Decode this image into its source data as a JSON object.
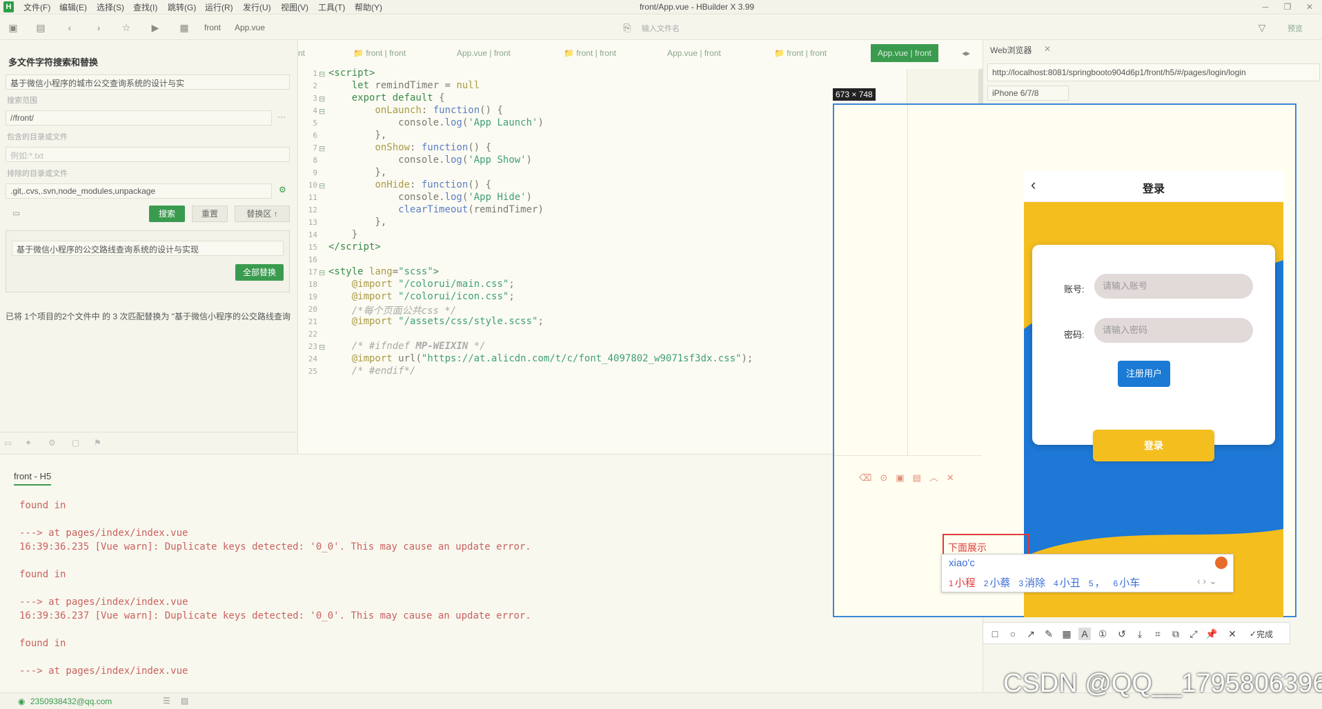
{
  "menubar": {
    "items": [
      "文件(F)",
      "编辑(E)",
      "选择(S)",
      "查找(I)",
      "跳转(G)",
      "运行(R)",
      "发行(U)",
      "视图(V)",
      "工具(T)",
      "帮助(Y)"
    ],
    "window_title": "front/App.vue - HBuilder X 3.99"
  },
  "toolbar": {
    "breadcrumb": [
      "front",
      "App.vue"
    ],
    "file_input_placeholder": "输入文件名",
    "preview_label": "预览"
  },
  "search_panel": {
    "title": "多文件字符搜索和替换",
    "search_value": "基于微信小程序的城市公交查询系统的设计与实",
    "scope_label": "搜索范围",
    "scope_value": "//front/",
    "include_label": "包含的目录或文件",
    "include_placeholder": "例如:*.txt",
    "exclude_label": "排除的目录或文件",
    "exclude_value": ".git,.cvs,.svn,node_modules,unpackage",
    "search_button": "搜索",
    "reset_button": "重置",
    "replace_toggle": "替换区 ↑",
    "replace_value": "基于微信小程序的公交路线查询系统的设计与实现",
    "replace_all_button": "全部替换",
    "result_text": "已将 1个项目的2个文件中 的 3 次匹配替换为 \"基于微信小程序的公交路线查询"
  },
  "editor": {
    "tabs": [
      "nt",
      "front | front",
      "App.vue | front",
      "front | front",
      "App.vue | front",
      "front | front",
      "App.vue | front"
    ],
    "code_lines": [
      {
        "n": "1",
        "fold": "⊟",
        "html": "<span class=\"kw\">&lt;script&gt;</span>"
      },
      {
        "n": "2",
        "fold": "",
        "html": "    <span class=\"kw\">let</span> remindTimer = <span class=\"prop\">null</span>"
      },
      {
        "n": "3",
        "fold": "⊟",
        "html": "    <span class=\"kw\">export default</span> {"
      },
      {
        "n": "4",
        "fold": "⊟",
        "html": "        <span class=\"prop\">onLaunch</span>: <span class=\"fn\">function</span>() {"
      },
      {
        "n": "5",
        "fold": "",
        "html": "            console.<span class=\"fn\">log</span>(<span class=\"str\">'App Launch'</span>)"
      },
      {
        "n": "6",
        "fold": "",
        "html": "        },"
      },
      {
        "n": "7",
        "fold": "⊟",
        "html": "        <span class=\"prop\">onShow</span>: <span class=\"fn\">function</span>() {"
      },
      {
        "n": "8",
        "fold": "",
        "html": "            console.<span class=\"fn\">log</span>(<span class=\"str\">'App Show'</span>)"
      },
      {
        "n": "9",
        "fold": "",
        "html": "        },"
      },
      {
        "n": "10",
        "fold": "⊟",
        "html": "        <span class=\"prop\">onHide</span>: <span class=\"fn\">function</span>() {"
      },
      {
        "n": "11",
        "fold": "",
        "html": "            console.<span class=\"fn\">log</span>(<span class=\"str\">'App Hide'</span>)"
      },
      {
        "n": "12",
        "fold": "",
        "html": "            <span class=\"fn\">clearTimeout</span>(remindTimer)"
      },
      {
        "n": "13",
        "fold": "",
        "html": "        },"
      },
      {
        "n": "14",
        "fold": "",
        "html": "    }"
      },
      {
        "n": "15",
        "fold": "",
        "html": "<span class=\"kw\">&lt;/script&gt;</span>"
      },
      {
        "n": "16",
        "fold": "",
        "html": ""
      },
      {
        "n": "17",
        "fold": "⊟",
        "html": "<span class=\"kw\">&lt;style</span> <span class=\"prop\">lang</span>=<span class=\"str\">\"scss\"</span><span class=\"kw\">&gt;</span>"
      },
      {
        "n": "18",
        "fold": "",
        "html": "    <span class=\"prop\">@import</span> <span class=\"str\">\"/colorui/main.css\"</span>;"
      },
      {
        "n": "19",
        "fold": "",
        "html": "    <span class=\"prop\">@import</span> <span class=\"str\">\"/colorui/icon.css\"</span>;"
      },
      {
        "n": "20",
        "fold": "",
        "html": "    <span class=\"cm\">/*每个页面公共css */</span>"
      },
      {
        "n": "21",
        "fold": "",
        "html": "    <span class=\"prop\">@import</span> <span class=\"str\">\"/assets/css/style.scss\"</span>;"
      },
      {
        "n": "22",
        "fold": "",
        "html": ""
      },
      {
        "n": "23",
        "fold": "⊟",
        "html": "    <span class=\"cm\">/* #ifndef <b>MP-WEIXIN</b> */</span>"
      },
      {
        "n": "24",
        "fold": "",
        "html": "    <span class=\"prop\">@import</span> url(<span class=\"str\">\"https://at.alicdn.com/t/c/font_4097802_w9071sf3dx.css\"</span>);"
      },
      {
        "n": "25",
        "fold": "",
        "html": "    <span class=\"cm\">/* #endif*/</span>"
      }
    ]
  },
  "console": {
    "tab": "front - H5",
    "lines": [
      "found in",
      "",
      "---> at pages/index/index.vue",
      "16:39:36.235 [Vue warn]: Duplicate keys detected: '0_0'. This may cause an update error.",
      "",
      "found in",
      "",
      "---> at pages/index/index.vue",
      "16:39:36.237 [Vue warn]: Duplicate keys detected: '0_0'. This may cause an update error.",
      "",
      "found in",
      "",
      "---> at pages/index/index.vue"
    ]
  },
  "webview": {
    "tab": "Web浏览器",
    "url": "http://localhost:8081/springbooto904d6p1/front/h5/#/pages/login/login",
    "device": "iPhone 6/7/8"
  },
  "capture": {
    "size_label": "673 × 748",
    "annotation_text": "下面展示"
  },
  "phone": {
    "title": "登录",
    "account_label": "账号:",
    "account_placeholder": "请输入账号",
    "password_label": "密码:",
    "password_placeholder": "请输入密码",
    "register_button": "注册用户",
    "login_button": "登录",
    "colors": {
      "yellow": "#f5be1f",
      "blue": "#1d78d6"
    }
  },
  "ime": {
    "composition": "xiao'c",
    "candidates": [
      {
        "n": "1",
        "w": "小程"
      },
      {
        "n": "2",
        "w": "小蔡"
      },
      {
        "n": "3",
        "w": "消除"
      },
      {
        "n": "4",
        "w": "小丑"
      },
      {
        "n": "5",
        "w": "，"
      },
      {
        "n": "6",
        "w": "小车"
      }
    ]
  },
  "capture_toolbar": {
    "done_label": "完成"
  },
  "statusbar": {
    "account": "2350938432@qq.com"
  },
  "watermark": "CSDN @QQ__1795806396"
}
